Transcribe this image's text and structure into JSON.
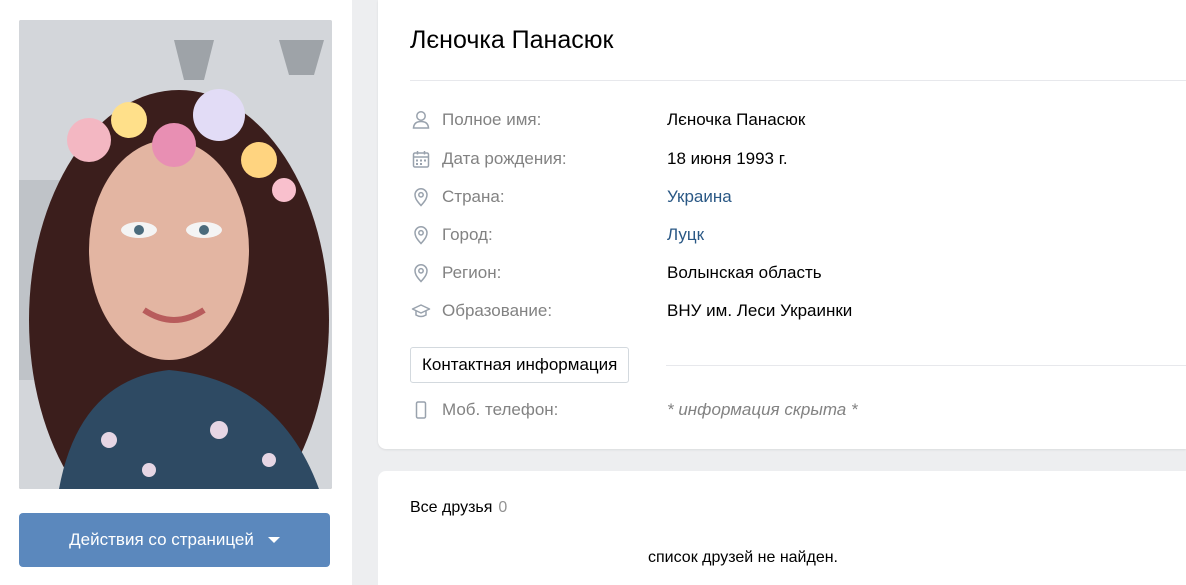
{
  "profile": {
    "name": "Лєночка Панасюк",
    "actions_label": "Действия со страницей"
  },
  "info": {
    "rows": [
      {
        "icon": "person-icon",
        "label": "Полное имя:",
        "value": "Лєночка Панасюк",
        "type": "text"
      },
      {
        "icon": "calendar-icon",
        "label": "Дата рождения:",
        "value": "18 июня 1993 г.",
        "type": "text"
      },
      {
        "icon": "location-pin-icon",
        "label": "Страна:",
        "value": "Украина",
        "type": "link"
      },
      {
        "icon": "location-pin-icon",
        "label": "Город:",
        "value": "Луцк",
        "type": "link"
      },
      {
        "icon": "location-pin-icon",
        "label": "Регион:",
        "value": "Волынская область",
        "type": "text"
      },
      {
        "icon": "graduation-cap-icon",
        "label": "Образование:",
        "value": "ВНУ им. Леси Украинки",
        "type": "text"
      }
    ],
    "contact_button": "Контактная информация",
    "phone": {
      "icon": "mobile-phone-icon",
      "label": "Моб. телефон:",
      "value": "* информация скрыта *"
    }
  },
  "friends": {
    "title": "Все друзья",
    "count": "0",
    "empty": "список друзей не найден."
  },
  "colors": {
    "accent": "#5b88bd",
    "link": "#2a5885",
    "muted": "#828282",
    "background": "#edeef0"
  }
}
